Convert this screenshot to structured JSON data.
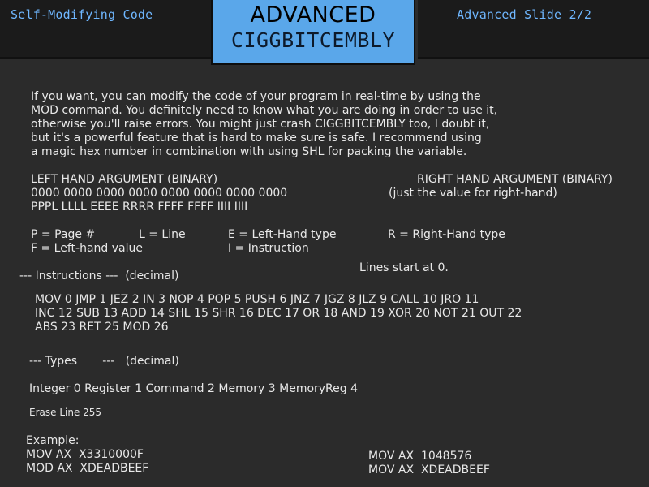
{
  "header": {
    "left_title": "Self-Modifying Code",
    "right_title": "Advanced Slide 2/2",
    "title_line1": "ADVANCED",
    "title_line2": "CIGGBITCEMBLY",
    "accent_color": "#5aa7ea",
    "header_text_color": "#6fb7ff"
  },
  "intro": [
    "If you want, you can modify the code of your program in real-time by using the",
    "MOD command. You definitely need to know what you are doing in order to use it,",
    "otherwise you'll raise errors. You might just crash CIGGBITCEMBLY too, I doubt it,",
    "but it's a powerful feature that is hard to make sure is safe. I recommend using",
    "a magic hex number in combination with using SHL for packing the variable."
  ],
  "args": {
    "left_heading": "LEFT HAND ARGUMENT (BINARY)",
    "right_heading": "RIGHT HAND ARGUMENT (BINARY)",
    "bits": "0000 0000 0000 0000 0000 0000 0000 0000",
    "right_note": "(just the value for right-hand)",
    "layout": "PPPL LLLL EEEE RRRR FFFF FFFF IIII IIII"
  },
  "legend": {
    "p": "P = Page #",
    "l": "L = Line",
    "e": "E = Left-Hand type",
    "r": "R = Right-Hand type",
    "f": "F = Left-hand value",
    "i": "I = Instruction"
  },
  "instructions": {
    "heading": "--- Instructions ---  (decimal)",
    "lines_note": "Lines start at 0.",
    "row1": "MOV 0 JMP 1 JEZ 2 IN 3 NOP 4 POP 5 PUSH 6 JNZ 7 JGZ 8 JLZ 9 CALL 10 JRO 11",
    "row2": "INC 12 SUB 13 ADD 14 SHL 15 SHR 16 DEC 17 OR 18 AND 19 XOR 20 NOT 21 OUT 22",
    "row3": "ABS 23 RET 25 MOD 26"
  },
  "types": {
    "heading": "--- Types       ---   (decimal)",
    "list": "Integer 0 Register 1 Command 2 Memory 3 MemoryReg 4",
    "erase": "Erase Line 255"
  },
  "example": {
    "label": "Example:",
    "left_line1": "MOV AX  X3310000F",
    "left_line2": "MOD AX  XDEADBEEF",
    "right_line1": "MOV AX  1048576",
    "right_line2": "MOV AX  XDEADBEEF"
  }
}
